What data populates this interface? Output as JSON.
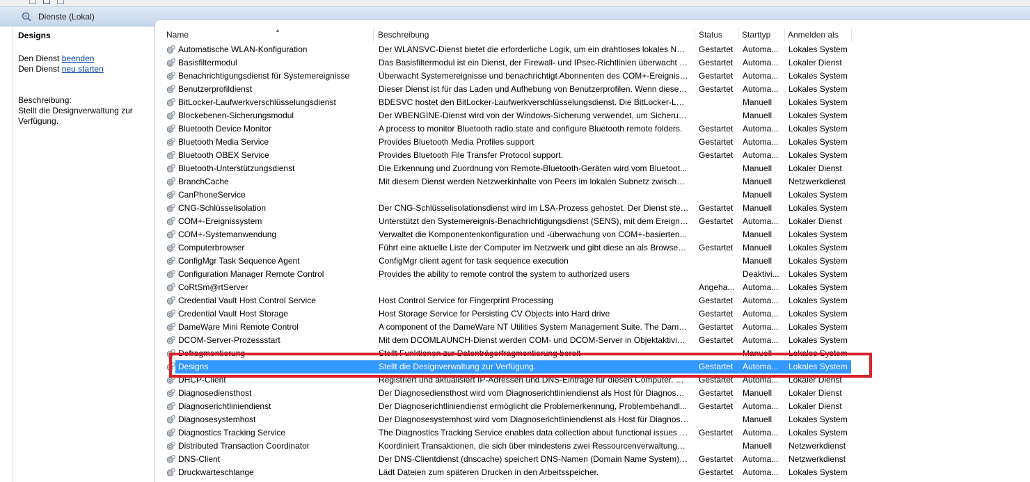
{
  "header": {
    "title": "Dienste (Lokal)"
  },
  "left_panel": {
    "service_name": "Designs",
    "stop_prefix": "Den Dienst ",
    "stop_link": "beenden",
    "restart_prefix": "Den Dienst ",
    "restart_link": "neu starten",
    "description_label": "Beschreibung:",
    "description_text": "Stellt die Designverwaltung zur Verfügung."
  },
  "columns": {
    "name": "Name",
    "description": "Beschreibung",
    "status": "Status",
    "startup": "Starttyp",
    "logon": "Anmelden als"
  },
  "rows": [
    {
      "name": "Automatische WLAN-Konfiguration",
      "desc": "Der WLANSVC-Dienst bietet die erforderliche Logik, um ein drahtloses lokales Netz...",
      "status": "Gestartet",
      "type": "Automa...",
      "logon": "Lokales System"
    },
    {
      "name": "Basisfiltermodul",
      "desc": "Das Basisfiltermodul ist ein Dienst, der Firewall- und IPsec-Richtlinien überwacht und ...",
      "status": "Gestartet",
      "type": "Automa...",
      "logon": "Lokaler Dienst"
    },
    {
      "name": "Benachrichtigungsdienst für Systemereignisse",
      "desc": "Überwacht Systemereignisse und benachrichtigt Abonnenten des COM+-Ereigniss...",
      "status": "Gestartet",
      "type": "Automa...",
      "logon": "Lokales System"
    },
    {
      "name": "Benutzerprofildienst",
      "desc": "Dieser Dienst ist für das Laden und Aufhebung von Benutzerprofilen. Wenn dieser D...",
      "status": "Gestartet",
      "type": "Automa...",
      "logon": "Lokales System"
    },
    {
      "name": "BitLocker-Laufwerkverschlüsselungsdienst",
      "desc": "BDESVC hostet den BitLocker-Laufwerkverschlüsselungsdienst. Die BitLocker-Laufw...",
      "status": "",
      "type": "Manuell",
      "logon": "Lokales System"
    },
    {
      "name": "Blockebenen-Sicherungsmodul",
      "desc": "Der WBENGINE-Dienst wird von der Windows-Sicherung verwendet, um Sicherung...",
      "status": "",
      "type": "Manuell",
      "logon": "Lokales System"
    },
    {
      "name": "Bluetooth Device Monitor",
      "desc": "A process to monitor Bluetooth radio state and configure Bluetooth remote folders.",
      "status": "Gestartet",
      "type": "Automa...",
      "logon": "Lokales System"
    },
    {
      "name": "Bluetooth Media Service",
      "desc": "Provides Bluetooth Media Profiles support",
      "status": "Gestartet",
      "type": "Automa...",
      "logon": "Lokales System"
    },
    {
      "name": "Bluetooth OBEX Service",
      "desc": "Provides Bluetooth File Transfer Protocol support.",
      "status": "Gestartet",
      "type": "Automa...",
      "logon": "Lokales System"
    },
    {
      "name": "Bluetooth-Unterstützungsdienst",
      "desc": "Die Erkennung und Zuordnung von Remote-Bluetooth-Geräten wird vom Bluetoot...",
      "status": "",
      "type": "Manuell",
      "logon": "Lokaler Dienst"
    },
    {
      "name": "BranchCache",
      "desc": "Mit diesem Dienst werden Netzwerkinhalte von Peers im lokalen Subnetz zwischen...",
      "status": "",
      "type": "Manuell",
      "logon": "Netzwerkdienst"
    },
    {
      "name": "CanPhoneService",
      "desc": "",
      "status": "",
      "type": "Manuell",
      "logon": "Lokales System"
    },
    {
      "name": "CNG-Schlüsselisolation",
      "desc": "Der CNG-Schlüsselisolationsdienst wird im LSA-Prozess gehostet. Der Dienst stellt e...",
      "status": "Gestartet",
      "type": "Manuell",
      "logon": "Lokales System"
    },
    {
      "name": "COM+-Ereignissystem",
      "desc": "Unterstützt den Systemereignis-Benachrichtigungsdienst (SENS), mit dem Ereigniss...",
      "status": "Gestartet",
      "type": "Automa...",
      "logon": "Lokaler Dienst"
    },
    {
      "name": "COM+-Systemanwendung",
      "desc": "Verwaltet die Komponentenkonfiguration und -überwachung von COM+-basierten...",
      "status": "",
      "type": "Manuell",
      "logon": "Lokales System"
    },
    {
      "name": "Computerbrowser",
      "desc": "Führt eine aktuelle Liste der Computer im Netzwerk und gibt diese an als Browser f...",
      "status": "Gestartet",
      "type": "Manuell",
      "logon": "Lokales System"
    },
    {
      "name": "ConfigMgr Task Sequence Agent",
      "desc": "ConfigMgr client agent for task sequence execution",
      "status": "",
      "type": "Manuell",
      "logon": "Lokales System"
    },
    {
      "name": "Configuration Manager Remote Control",
      "desc": "Provides the ability to remote control the system to authorized users",
      "status": "",
      "type": "Deaktivi...",
      "logon": "Lokales System"
    },
    {
      "name": "CoRtSm@rtServer",
      "desc": "",
      "status": "Angeha...",
      "type": "Automa...",
      "logon": "Lokales System"
    },
    {
      "name": "Credential Vault Host Control Service",
      "desc": "Host Control Service for Fingerprint Processing",
      "status": "Gestartet",
      "type": "Automa...",
      "logon": "Lokales System"
    },
    {
      "name": "Credential Vault Host Storage",
      "desc": "Host Storage Service for Persisting CV Objects into Hard drive",
      "status": "Gestartet",
      "type": "Automa...",
      "logon": "Lokales System"
    },
    {
      "name": "DameWare Mini Remote Control",
      "desc": "A component of the DameWare NT Utilities System Management Suite.  The Dame...",
      "status": "Gestartet",
      "type": "Automa...",
      "logon": "Lokales System"
    },
    {
      "name": "DCOM-Server-Prozessstart",
      "desc": "Mit dem DCOMLAUNCH-Dienst werden COM- und DCOM-Server in Objektaktivier...",
      "status": "Gestartet",
      "type": "Automa...",
      "logon": "Lokales System"
    },
    {
      "name": "Defragmentierung",
      "desc": "Stellt Funktionen zur Datenträgerfragmentierung bereit",
      "status": "",
      "type": "Manuell",
      "logon": "Lokales System"
    },
    {
      "name": "Designs",
      "desc": "Stellt die Designverwaltung zur Verfügung.",
      "status": "Gestartet",
      "type": "Automa...",
      "logon": "Lokales System",
      "selected": true
    },
    {
      "name": "DHCP-Client",
      "desc": "Registriert und aktualisiert IP-Adressen und DNS-Einträge für diesen Computer. Die...",
      "status": "Gestartet",
      "type": "Automa...",
      "logon": "Lokaler Dienst"
    },
    {
      "name": "Diagnosediensthost",
      "desc": "Der Diagnosediensthost wird vom Diagnoserichtliniendienst als Host für Diagnosen...",
      "status": "Gestartet",
      "type": "Manuell",
      "logon": "Lokaler Dienst"
    },
    {
      "name": "Diagnoserichtliniendienst",
      "desc": "Der Diagnoserichtliniendienst ermöglicht die Problemerkennung,  Problembehandl...",
      "status": "Gestartet",
      "type": "Automa...",
      "logon": "Lokaler Dienst"
    },
    {
      "name": "Diagnosesystemhost",
      "desc": "Der Diagnosesystemhost wird vom Diagnoserichtliniendienst als Host für Diagnose...",
      "status": "",
      "type": "Manuell",
      "logon": "Lokales System"
    },
    {
      "name": "Diagnostics Tracking Service",
      "desc": "The Diagnostics Tracking Service enables data collection about functional issues in ...",
      "status": "Gestartet",
      "type": "Automa...",
      "logon": "Lokales System"
    },
    {
      "name": "Distributed Transaction Coordinator",
      "desc": "Koordiniert Transaktionen, die sich über mindestens zwei Ressourcenverwaltungen ...",
      "status": "",
      "type": "Manuell",
      "logon": "Netzwerkdienst"
    },
    {
      "name": "DNS-Client",
      "desc": "Der DNS-Clientdienst (dnscache) speichert DNS-Namen (Domain Name System) z...",
      "status": "Gestartet",
      "type": "Automa...",
      "logon": "Netzwerkdienst"
    },
    {
      "name": "Druckwarteschlange",
      "desc": "Lädt Dateien zum späteren Drucken in den Arbeitsspeicher.",
      "status": "Gestartet",
      "type": "Automa...",
      "logon": "Lokales System"
    }
  ],
  "colors": {
    "selection": "#3399ff",
    "highlight_box": "#d8232a",
    "link": "#0645ad"
  },
  "icons": {
    "header": "services-search-icon",
    "row": "service-gear-icon",
    "sort": "sort-ascending-icon"
  }
}
